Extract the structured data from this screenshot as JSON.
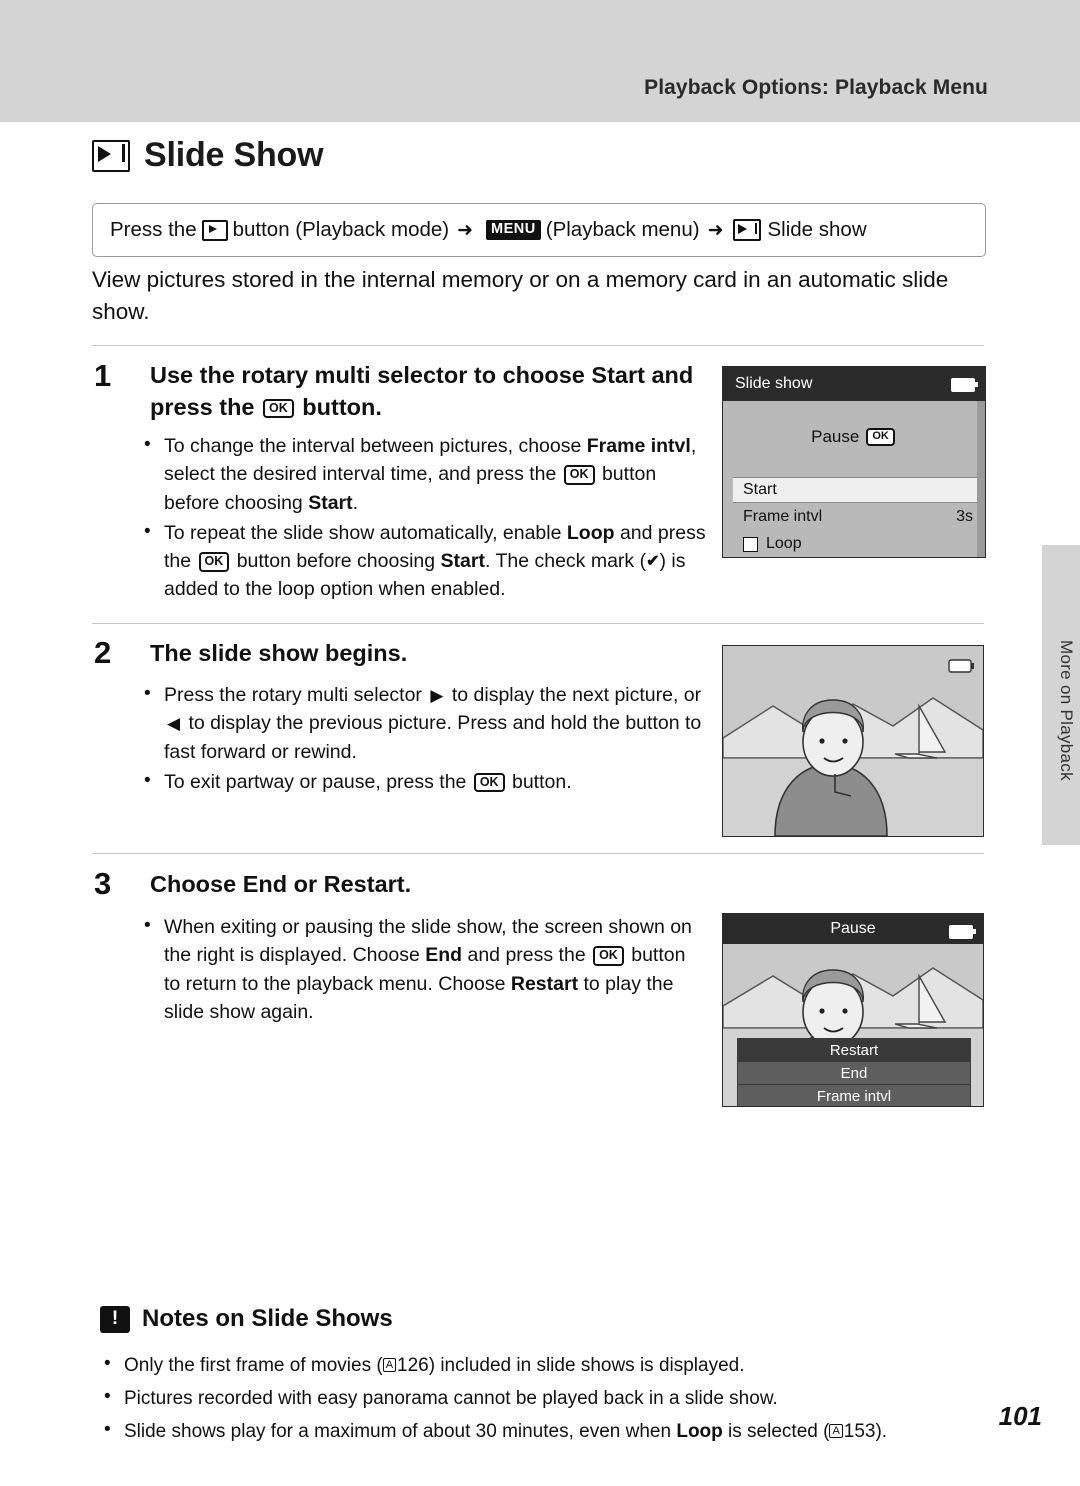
{
  "header": {
    "title": "Playback Options: Playback Menu"
  },
  "side_tab": {
    "label": "More on Playback"
  },
  "page_title": {
    "text": "Slide Show",
    "icon": "slide-show-icon"
  },
  "path_box": {
    "press_the": "Press the",
    "playback_mode": "button (Playback mode)",
    "menu_label": "MENU",
    "playback_menu": "(Playback menu)",
    "slide_show": "Slide show",
    "arrow": "➜"
  },
  "intro": "View pictures stored in the internal memory or on a memory card in an automatic slide show.",
  "steps": [
    {
      "number": "1",
      "heading_pre": "Use the rotary multi selector to choose ",
      "heading_bold": "Start",
      "heading_post": " and press the ",
      "heading_end": " button.",
      "bullets": [
        {
          "parts": [
            {
              "t": "To change the interval between pictures, choose "
            },
            {
              "t": "Frame intvl",
              "bold": true
            },
            {
              "t": ", select the desired interval time, and press the "
            },
            {
              "t": "OK-ICON"
            },
            {
              "t": " button before choosing "
            },
            {
              "t": "Start",
              "bold": true
            },
            {
              "t": "."
            }
          ]
        },
        {
          "parts": [
            {
              "t": "To repeat the slide show automatically, enable "
            },
            {
              "t": "Loop",
              "bold": true
            },
            {
              "t": " and press the "
            },
            {
              "t": "OK-ICON"
            },
            {
              "t": " button before choosing "
            },
            {
              "t": "Start",
              "bold": true
            },
            {
              "t": ". The check mark ("
            },
            {
              "t": "CHECK-ICON"
            },
            {
              "t": ") is added to the loop option when enabled."
            }
          ]
        }
      ]
    },
    {
      "number": "2",
      "heading_pre": "The slide show begins.",
      "heading_bold": "",
      "heading_post": "",
      "heading_end": "",
      "bullets": [
        {
          "parts": [
            {
              "t": "Press the rotary multi selector "
            },
            {
              "t": "RIGHT-ICON"
            },
            {
              "t": " to display the next picture, or "
            },
            {
              "t": "LEFT-ICON"
            },
            {
              "t": " to display the previous picture. Press and hold the button to fast forward or rewind."
            }
          ]
        },
        {
          "parts": [
            {
              "t": "To exit partway or pause, press the "
            },
            {
              "t": "OK-ICON"
            },
            {
              "t": " button."
            }
          ]
        }
      ]
    },
    {
      "number": "3",
      "heading_pre": "Choose End or Restart.",
      "heading_bold": "",
      "heading_post": "",
      "heading_end": "",
      "bullets": [
        {
          "parts": [
            {
              "t": "When exiting or pausing the slide show, the screen shown on the right is displayed. Choose "
            },
            {
              "t": "End",
              "bold": true
            },
            {
              "t": " and press the "
            },
            {
              "t": "OK-ICON"
            },
            {
              "t": " button to return to the playback menu. Choose "
            },
            {
              "t": "Restart",
              "bold": true
            },
            {
              "t": " to play the slide show again."
            }
          ]
        }
      ]
    }
  ],
  "screen1": {
    "title": "Slide show",
    "pause_label": "Pause",
    "rows": [
      {
        "label": "Start",
        "value": "",
        "selected": true
      },
      {
        "label": "Frame intvl",
        "value": "3s",
        "selected": false
      },
      {
        "label": "Loop",
        "value": "",
        "selected": false,
        "checkbox": true
      }
    ]
  },
  "screen3": {
    "title": "Pause",
    "rows": [
      {
        "label": "Restart",
        "selected": true
      },
      {
        "label": "End",
        "selected": false
      },
      {
        "label": "Frame intvl",
        "selected": false
      }
    ]
  },
  "notes": {
    "title": "Notes on Slide Shows",
    "items": [
      {
        "parts": [
          {
            "t": "Only the first frame of movies ("
          },
          {
            "t": "BOOK-ICON"
          },
          {
            "t": "126) included in slide shows is displayed."
          }
        ]
      },
      {
        "parts": [
          {
            "t": "Pictures recorded with easy panorama cannot be played back in a slide show."
          }
        ]
      },
      {
        "parts": [
          {
            "t": "Slide shows play for a maximum of about 30 minutes, even when "
          },
          {
            "t": "Loop",
            "bold": true
          },
          {
            "t": " is selected ("
          },
          {
            "t": "BOOK-ICON"
          },
          {
            "t": "153)."
          }
        ]
      }
    ]
  },
  "page_number": "101"
}
